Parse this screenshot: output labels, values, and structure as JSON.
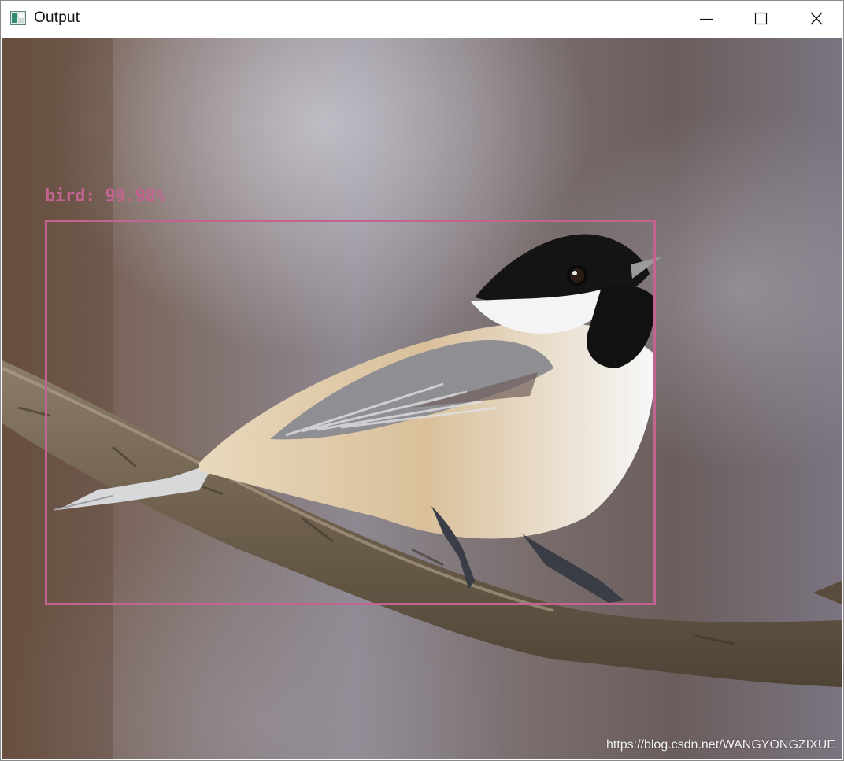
{
  "window": {
    "title": "Output",
    "controls": {
      "minimize_icon": "minimize-icon",
      "maximize_icon": "maximize-icon",
      "close_icon": "close-icon"
    }
  },
  "detection": {
    "label": "bird: 99.98%",
    "color": "#c2648f"
  },
  "watermark": "https://blog.csdn.net/WANGYONGZIXUE"
}
